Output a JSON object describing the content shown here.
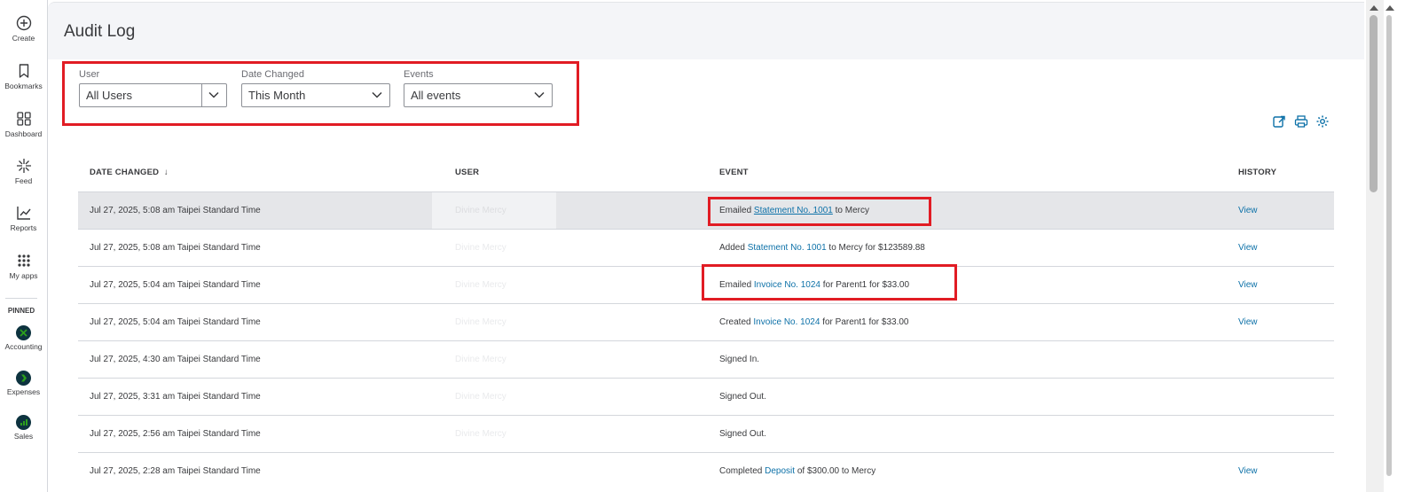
{
  "nav": {
    "items": [
      {
        "label": "Create",
        "icon": "plus-circle-icon"
      },
      {
        "label": "Bookmarks",
        "icon": "bookmark-icon"
      },
      {
        "label": "Dashboard",
        "icon": "dashboard-icon"
      },
      {
        "label": "Feed",
        "icon": "feed-icon"
      },
      {
        "label": "Reports",
        "icon": "reports-icon"
      },
      {
        "label": "My apps",
        "icon": "apps-grid-icon"
      }
    ],
    "pinned_title": "PINNED",
    "pinned": [
      {
        "label": "Accounting",
        "icon": "accounting-icon"
      },
      {
        "label": "Expenses",
        "icon": "expenses-icon"
      },
      {
        "label": "Sales",
        "icon": "sales-icon"
      }
    ]
  },
  "header": {
    "title": "Audit Log"
  },
  "filters": {
    "user": {
      "label": "User",
      "value": "All Users"
    },
    "date": {
      "label": "Date Changed",
      "value": "This Month"
    },
    "events": {
      "label": "Events",
      "value": "All events"
    }
  },
  "table": {
    "columns": {
      "date": "DATE CHANGED",
      "sort_indicator": "↓",
      "user": "USER",
      "event": "EVENT",
      "history": "HISTORY"
    },
    "rows": [
      {
        "date": "Jul 27, 2025, 5:08 am Taipei Standard Time",
        "user": "Divine Mercy",
        "event_pre": "Emailed ",
        "event_link": "Statement No. 1001",
        "event_post": " to Mercy",
        "history": "View"
      },
      {
        "date": "Jul 27, 2025, 5:08 am Taipei Standard Time",
        "user": "Divine Mercy",
        "event_pre": "Added ",
        "event_link": "Statement No. 1001",
        "event_post": " to Mercy for $123589.88",
        "history": "View"
      },
      {
        "date": "Jul 27, 2025, 5:04 am Taipei Standard Time",
        "user": "Divine Mercy",
        "event_pre": "Emailed ",
        "event_link": "Invoice No. 1024",
        "event_post": " for Parent1 for $33.00",
        "history": "View"
      },
      {
        "date": "Jul 27, 2025, 5:04 am Taipei Standard Time",
        "user": "Divine Mercy",
        "event_pre": "Created ",
        "event_link": "Invoice No. 1024",
        "event_post": " for Parent1 for $33.00",
        "history": "View"
      },
      {
        "date": "Jul 27, 2025, 4:30 am Taipei Standard Time",
        "user": "Divine Mercy",
        "event_pre": "Signed In.",
        "event_link": "",
        "event_post": "",
        "history": ""
      },
      {
        "date": "Jul 27, 2025, 3:31 am Taipei Standard Time",
        "user": "Divine Mercy",
        "event_pre": "Signed Out.",
        "event_link": "",
        "event_post": "",
        "history": ""
      },
      {
        "date": "Jul 27, 2025, 2:56 am Taipei Standard Time",
        "user": "Divine Mercy",
        "event_pre": "Signed Out.",
        "event_link": "",
        "event_post": "",
        "history": ""
      },
      {
        "date": "Jul 27, 2025, 2:28 am Taipei Standard Time",
        "user": "",
        "event_pre": "Completed ",
        "event_link": "Deposit",
        "event_post": " of $300.00 to Mercy",
        "history": "View"
      }
    ]
  },
  "colors": {
    "accent": "#0d71a8",
    "highlight_border": "#e11c24",
    "app_icon": "#0d333f",
    "app_icon_glyph": "#2ca01c"
  }
}
